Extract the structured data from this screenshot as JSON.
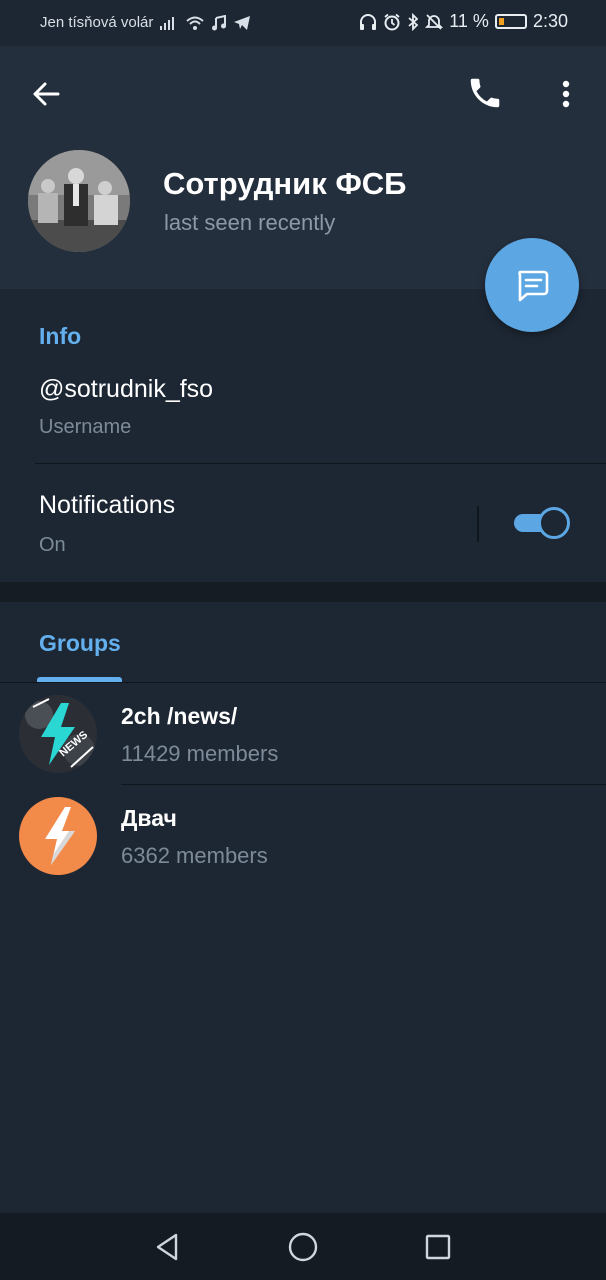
{
  "status_bar": {
    "carrier": "Jen tísňová volár",
    "battery_percent": "11 %",
    "time": "2:30",
    "icons": [
      "signal-icon",
      "wifi-icon",
      "music-icon",
      "telegram-icon",
      "headphones-icon",
      "alarm-icon",
      "bluetooth-icon",
      "mute-icon",
      "battery-icon"
    ]
  },
  "header": {
    "back_icon": "back-arrow-icon",
    "call_icon": "phone-icon",
    "more_icon": "more-vertical-icon"
  },
  "profile": {
    "name": "Сотрудник ФСБ",
    "status": "last seen recently"
  },
  "fab": {
    "icon": "message-icon"
  },
  "info": {
    "title": "Info",
    "username_value": "@sotrudnik_fso",
    "username_label": "Username",
    "notifications_label": "Notifications",
    "notifications_value": "On",
    "notifications_enabled": true
  },
  "groups": {
    "tab_label": "Groups",
    "items": [
      {
        "name": "2ch /news/",
        "members": "11429 members"
      },
      {
        "name": "Двач",
        "members": "6362 members"
      }
    ]
  },
  "nav_bar": {
    "icons": [
      "nav-back-icon",
      "nav-home-icon",
      "nav-recents-icon"
    ]
  },
  "colors": {
    "accent": "#64b0ee",
    "fab": "#5ca7e3",
    "header_bg": "#242f3d",
    "body_bg": "#1d2733",
    "group2_avatar": "#f28a4a"
  }
}
